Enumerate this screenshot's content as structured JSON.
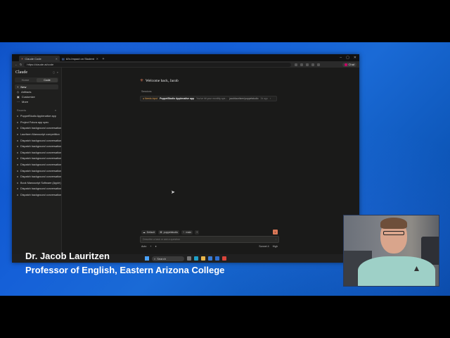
{
  "browser": {
    "tabs": [
      {
        "label": "Claude Code",
        "active": true
      },
      {
        "label": "AI's Impact on Student Cognitive",
        "active": false
      }
    ],
    "new_tab": "+",
    "url": "https://claude.ai/code",
    "profile": "Chat"
  },
  "sidebar": {
    "brand": "Claude",
    "mode_tabs": [
      {
        "label": "Home"
      },
      {
        "label": "Code"
      }
    ],
    "nav": [
      {
        "label": "New",
        "icon": "plus-icon"
      },
      {
        "label": "Artifacts",
        "icon": "artifacts-icon"
      },
      {
        "label": "Customize",
        "icon": "customize-icon"
      },
      {
        "label": "More",
        "icon": "more-icon"
      }
    ],
    "recents_label": "Recents",
    "recents": [
      "PuppetStudio Applenative app",
      "Project Futura app spec",
      "Dispatch background conversation",
      "Lauritzen Manuscript competition",
      "Dispatch background conversation",
      "Dispatch background conversation",
      "Dispatch background conversation",
      "Dispatch background conversation",
      "Dispatch background conversation",
      "Dispatch background conversation",
      "Dispatch background conversation",
      "Book Manuscript Software (Apple)",
      "Dispatch background conversation",
      "Dispatch background conversation"
    ],
    "user": {
      "initial": "J",
      "name": "Jacob",
      "plan": "Max"
    }
  },
  "main": {
    "welcome": "Welcome back, Jacob",
    "sessions_label": "Sessions",
    "session": {
      "status": "Needs input",
      "name": "PuppetStudio Applenative app",
      "desc": "You've hit your monthly spe...",
      "branch": "jacoblauritzen/puppetstudio",
      "age": "2d ago"
    },
    "chips": [
      {
        "label": "Default"
      },
      {
        "label": "puppetstudio"
      },
      {
        "label": "main"
      },
      {
        "label": "+"
      }
    ],
    "composer_placeholder": "Describe a task or ask a question",
    "footer_left": "Auto",
    "footer_plus": "+",
    "footer_model": "Sonnet 4",
    "footer_effort": "High"
  },
  "taskbar": {
    "search": "Search"
  },
  "caption": {
    "name": "Dr. Jacob Lauritzen",
    "title": "Professor of English, Eastern Arizona College"
  }
}
